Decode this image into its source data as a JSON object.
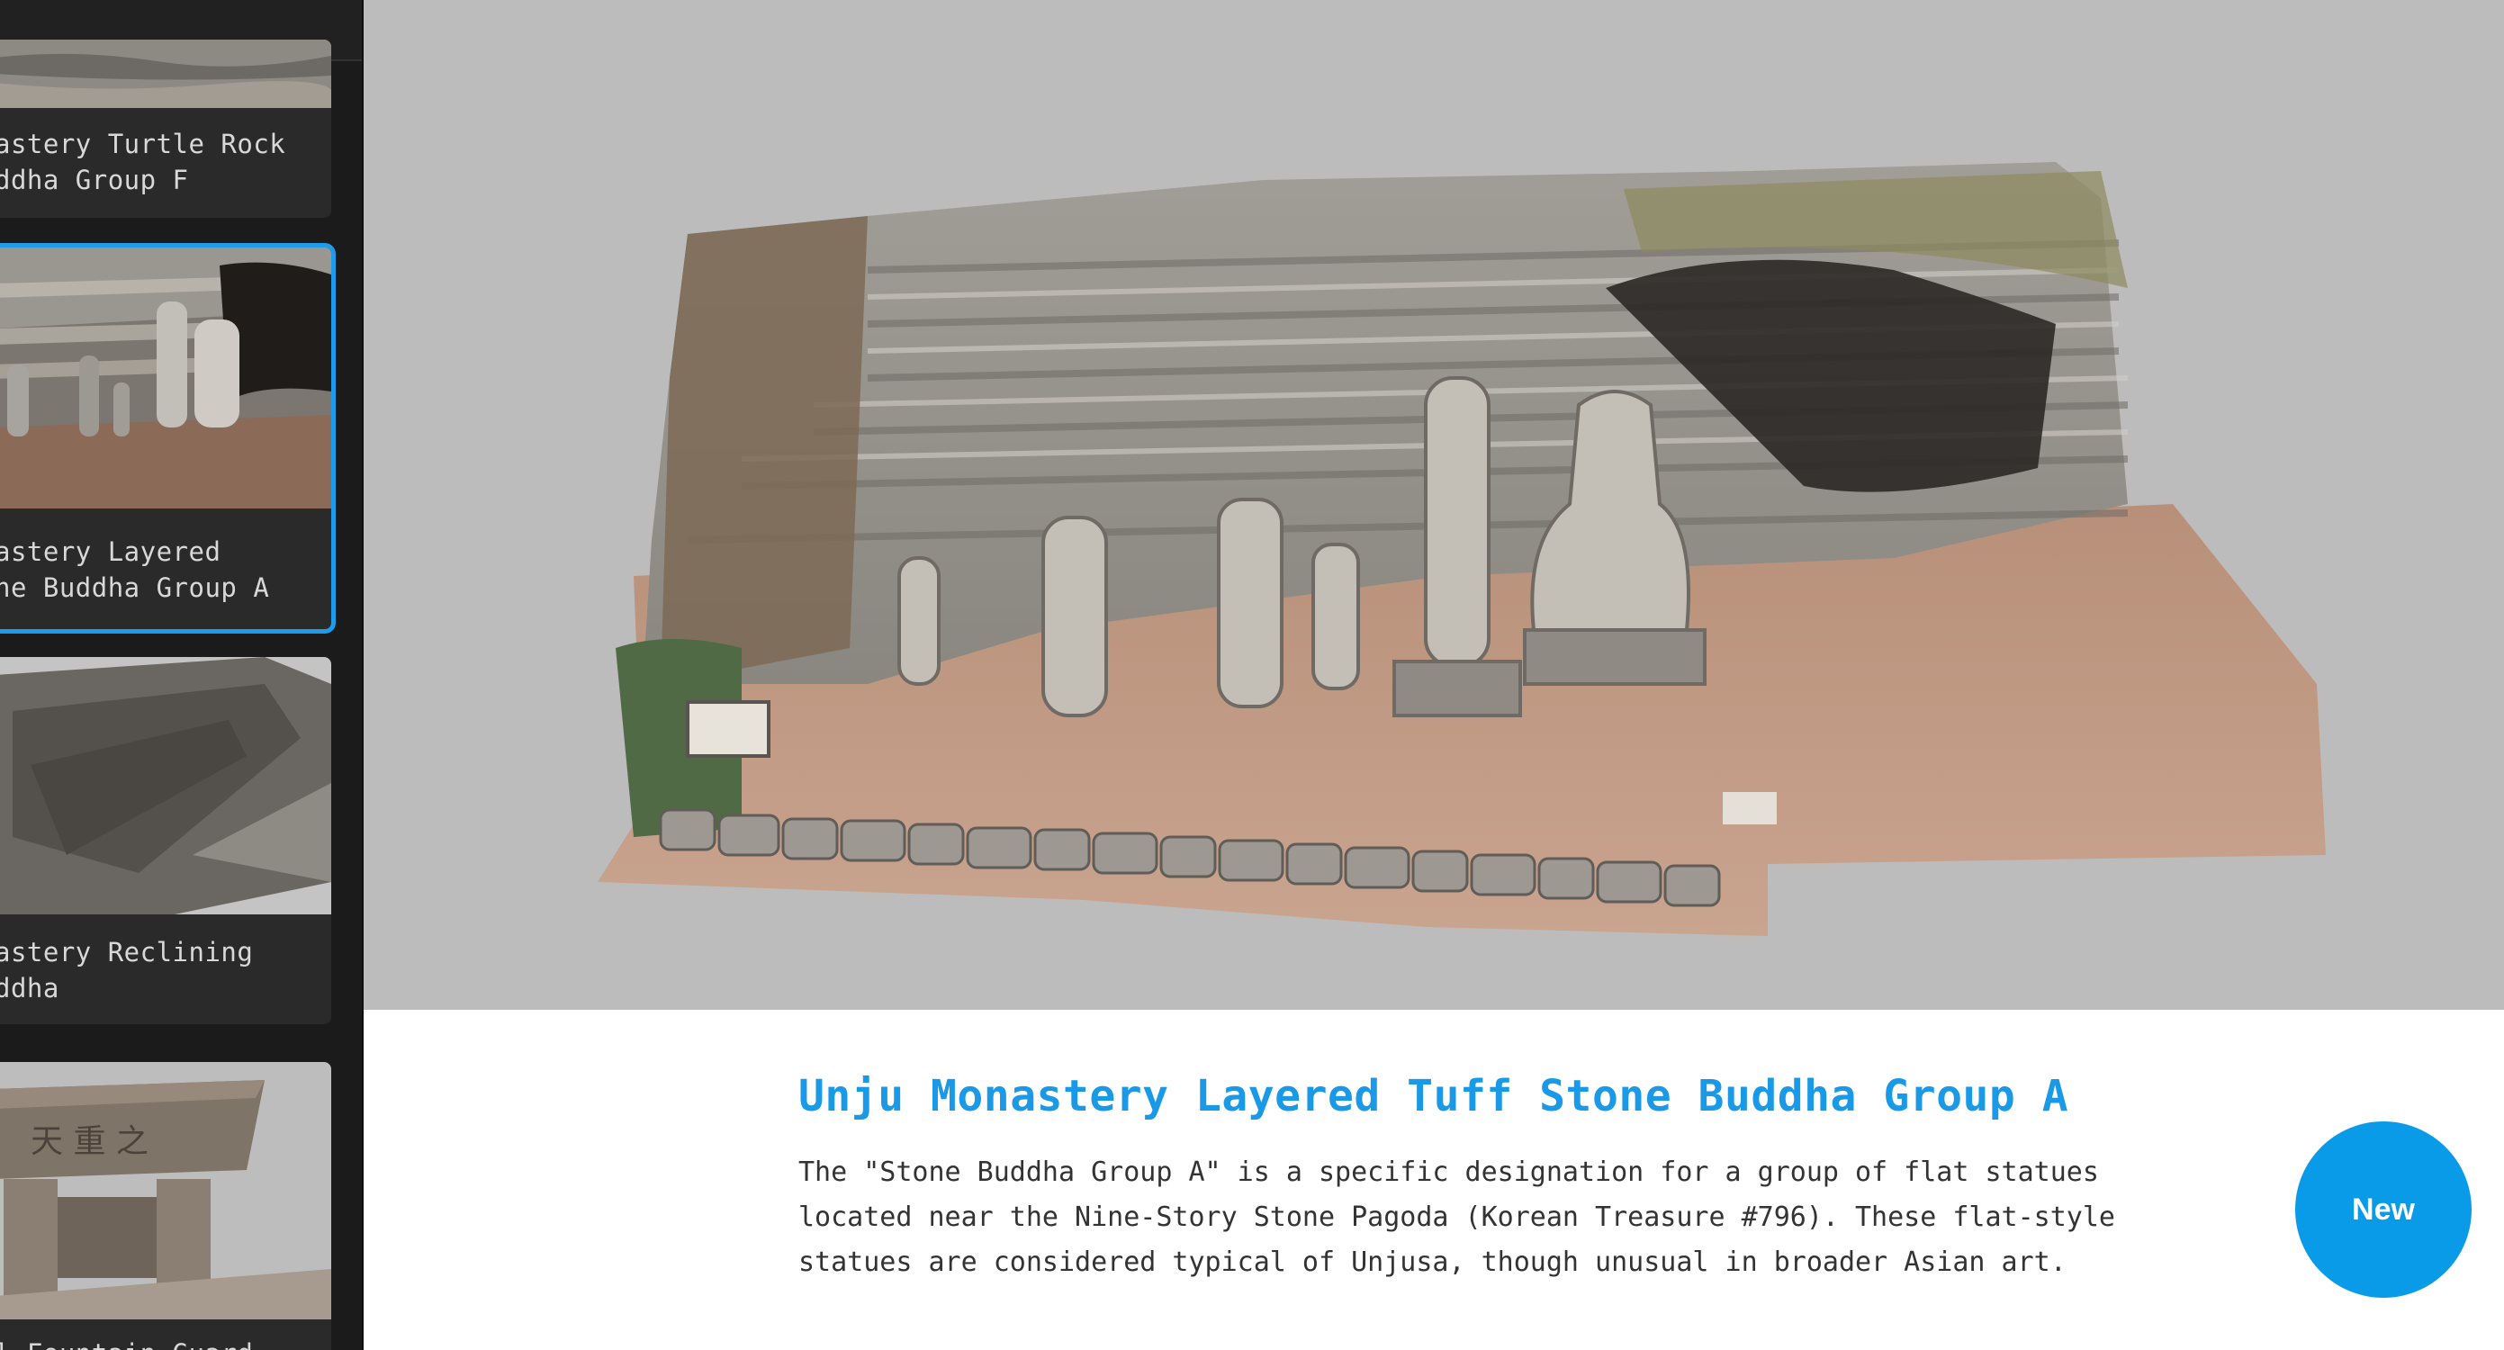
{
  "sidebar": {
    "items": [
      {
        "label": "astery Turtle Rock\nddha Group F",
        "selected": false
      },
      {
        "label": "astery Layered\nne Buddha Group A",
        "selected": true
      },
      {
        "label": "astery Reclining\nddha",
        "selected": false
      },
      {
        "label": "l Fountain Guard",
        "selected": false
      }
    ]
  },
  "model": {
    "title": "Unju Monastery Layered Tuff Stone Buddha Group A",
    "description": "The \"Stone Buddha Group A\" is a specific designation for a group of flat statues located near the Nine-Story Stone Pagoda (Korean Treasure #796). These flat-style statues are considered typical of Unjusa, though unusual in broader Asian art."
  },
  "actions": {
    "new_label": "New"
  },
  "colors": {
    "accent": "#1a99e6",
    "button": "#0a9be8",
    "viewer_bg": "#bcbcbc",
    "sidebar_bg": "#1b1b1b"
  }
}
